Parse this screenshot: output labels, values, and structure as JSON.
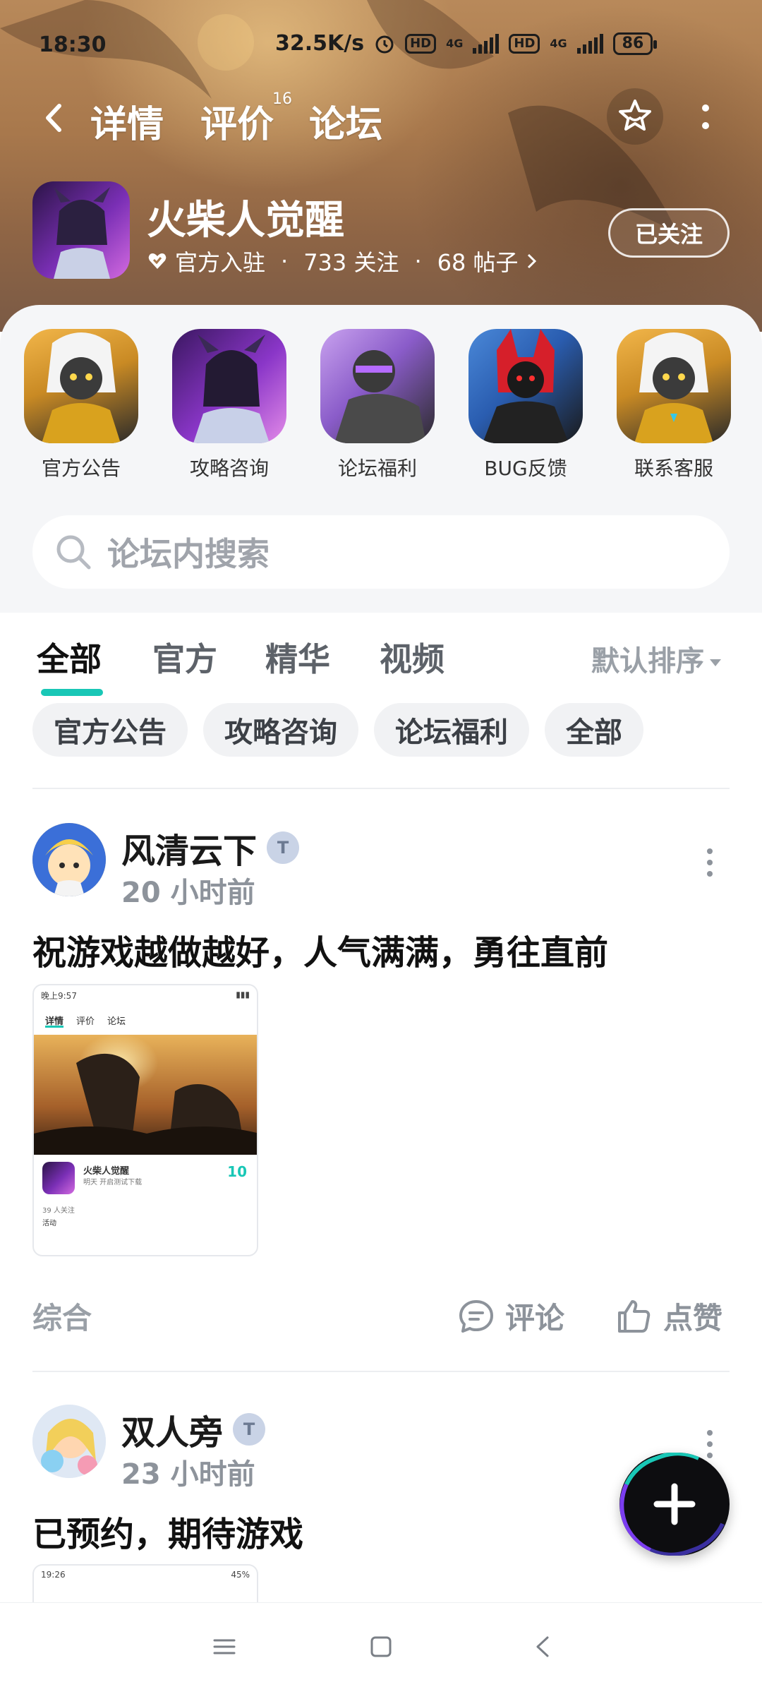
{
  "status": {
    "time": "18:30",
    "speed": "32.5K/s",
    "hd1": "HD",
    "net1": "4G",
    "hd2": "HD",
    "net2": "4G",
    "battery": "86"
  },
  "nav": {
    "tabs": [
      {
        "label": "详情"
      },
      {
        "label": "评价",
        "sup": "16"
      },
      {
        "label": "论坛"
      }
    ],
    "active_tab": "论坛"
  },
  "game": {
    "title": "火柴人觉醒",
    "official": "官方入驻",
    "follows": "733 关注",
    "posts": "68 帖子",
    "follow_button": "已关注"
  },
  "quick_links": [
    {
      "label": "官方公告",
      "icon": "knight-portrait"
    },
    {
      "label": "攻略咨询",
      "icon": "demon-portrait"
    },
    {
      "label": "论坛福利",
      "icon": "dark-warrior-portrait"
    },
    {
      "label": "BUG反馈",
      "icon": "red-wolf-portrait"
    },
    {
      "label": "联系客服",
      "icon": "knight-portrait"
    }
  ],
  "search": {
    "placeholder": "论坛内搜索"
  },
  "filter_tabs": [
    {
      "label": "全部"
    },
    {
      "label": "官方"
    },
    {
      "label": "精华"
    },
    {
      "label": "视频"
    }
  ],
  "sort_label": "默认排序",
  "chips": [
    "官方公告",
    "攻略咨询",
    "论坛福利",
    "全部"
  ],
  "posts": [
    {
      "author": "风清云下",
      "badge": "T",
      "time": "20 小时前",
      "text": "祝游戏越做越好，人气满满，勇往直前",
      "category": "综合",
      "comment_label": "评论",
      "like_label": "点赞",
      "thumb": {
        "status_time": "晚上9:57",
        "tabs": [
          "详情",
          "评价",
          "论坛"
        ],
        "title": "火柴人觉醒",
        "subtitle": "明天 开启测试下载",
        "score": "10",
        "follows": "39 人关注",
        "activity": "活动"
      }
    },
    {
      "author": "双人旁",
      "badge": "T",
      "time": "23 小时前",
      "text": "已预约，期待游戏",
      "thumb": {
        "status_time": "19:26",
        "battery": "45%"
      }
    }
  ],
  "colors": {
    "accent": "#19c7b6",
    "banner": "#a8784c"
  }
}
